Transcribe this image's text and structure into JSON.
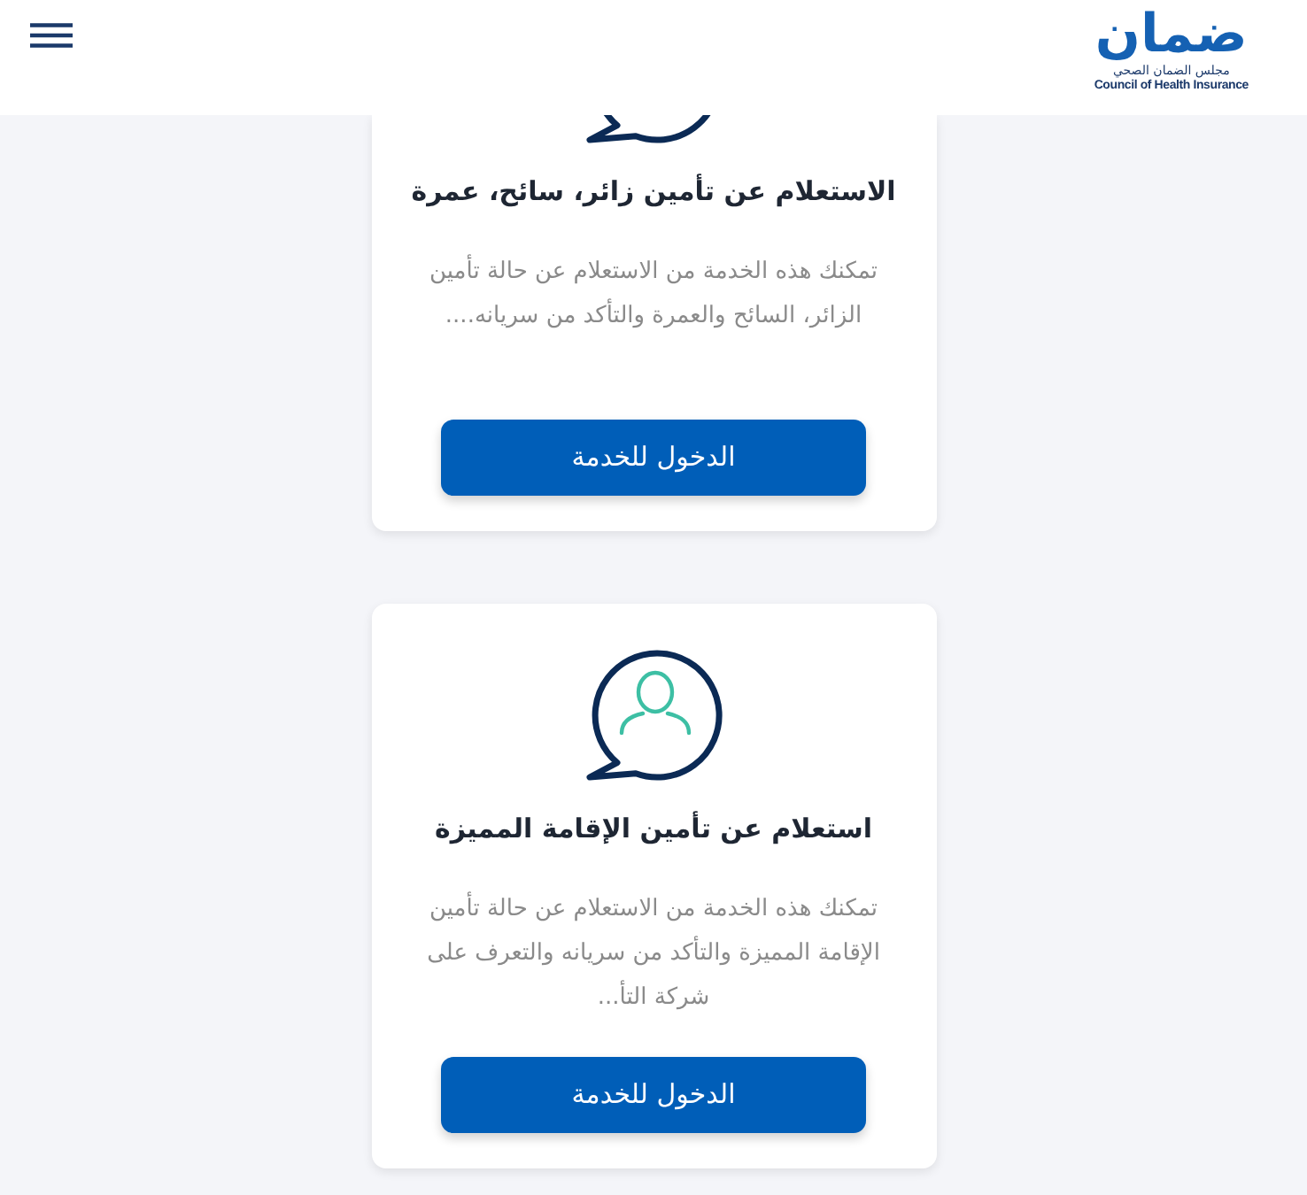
{
  "header": {
    "logo": {
      "wordmark": "ضمان",
      "name_ar": "مجلس الضمان الصحي",
      "name_en": "Council of Health Insurance"
    }
  },
  "services": [
    {
      "title": "الاستعلام عن تأمين زائر، سائح، عمرة",
      "description": "تمكنك هذه الخدمة من الاستعلام عن حالة تأمين الزائر، السائح والعمرة والتأكد من سريانه....",
      "button": "الدخول للخدمة"
    },
    {
      "title": "استعلام عن تأمين الإقامة المميزة",
      "description": "تمكنك هذه الخدمة من الاستعلام عن حالة تأمين الإقامة المميزة والتأكد من سريانه والتعرف على شركة التأ...",
      "button": "الدخول للخدمة"
    }
  ]
}
